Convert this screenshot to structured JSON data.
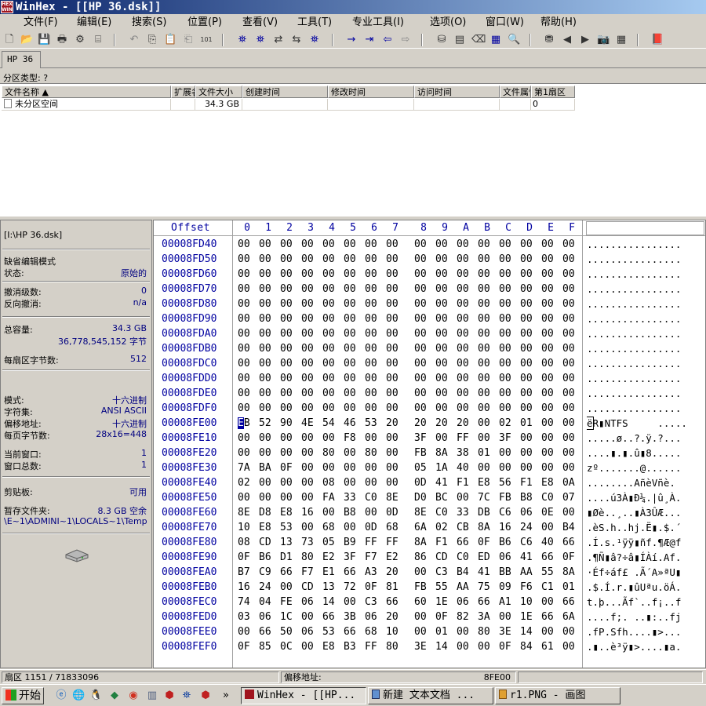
{
  "window": {
    "title": "WinHex - [[HP 36.dsk]]",
    "logo_top": "HEX",
    "logo_bottom": "WIN"
  },
  "menu": [
    {
      "label": "文件(F)"
    },
    {
      "label": "编辑(E)"
    },
    {
      "label": "搜索(S)"
    },
    {
      "label": "位置(P)"
    },
    {
      "label": "查看(V)"
    },
    {
      "label": "工具(T)"
    },
    {
      "label": "专业工具(I)"
    },
    {
      "label": "选项(O)"
    },
    {
      "label": "窗口(W)"
    },
    {
      "label": "帮助(H)"
    }
  ],
  "tab": {
    "label": "HP 36"
  },
  "partition_type": "分区类型: ?",
  "file_table": {
    "columns": [
      "文件名称 ▲",
      "扩展名",
      "文件大小",
      "创建时间",
      "修改时间",
      "访问时间",
      "文件属性",
      "第1扇区"
    ],
    "rows": [
      {
        "name": "未分区空间",
        "ext": "",
        "size": "34.3 GB",
        "created": "",
        "modified": "",
        "accessed": "",
        "attr": "",
        "first_sector": "0"
      }
    ]
  },
  "info": {
    "path": "[I:\\HP 36.dsk]",
    "edit_mode": "缺省编辑模式",
    "state_label": "状态:",
    "state_val": "原始的",
    "undo_level_label": "撤消级数:",
    "undo_level_val": "0",
    "reverse_undo_label": "反向撤消:",
    "reverse_undo_val": "n/a",
    "capacity_label": "总容量:",
    "capacity_val": "34.3 GB",
    "capacity_bytes": "36,778,545,152 字节",
    "bytes_per_sector_label": "每扇区字节数:",
    "bytes_per_sector_val": "512",
    "mode_label": "模式:",
    "mode_val": "十六进制",
    "charset_label": "字符集:",
    "charset_val": "ANSI ASCII",
    "offset_addr_label": "偏移地址:",
    "offset_addr_val": "十六进制",
    "bytes_per_page_label": "每页字节数:",
    "bytes_per_page_val": "28x16=448",
    "cur_window_label": "当前窗口:",
    "cur_window_val": "1",
    "window_count_label": "窗口总数:",
    "window_count_val": "1",
    "clipboard_label": "剪贴板:",
    "clipboard_val": "可用",
    "temp_folder_label": "暂存文件夹:",
    "temp_folder_val": "8.3 GB 空余",
    "temp_folder_path": "\\E~1\\ADMINI~1\\LOCALS~1\\Temp"
  },
  "hex": {
    "offset_header": "Offset",
    "columns": [
      "0",
      "1",
      "2",
      "3",
      "4",
      "5",
      "6",
      "7",
      "8",
      "9",
      "A",
      "B",
      "C",
      "D",
      "E",
      "F"
    ],
    "rows": [
      {
        "offset": "00008FD40",
        "hex": "00 00 00 00 00 00 00 00  00 00 00 00 00 00 00 00",
        "ascii": "................"
      },
      {
        "offset": "00008FD50",
        "hex": "00 00 00 00 00 00 00 00  00 00 00 00 00 00 00 00",
        "ascii": "................"
      },
      {
        "offset": "00008FD60",
        "hex": "00 00 00 00 00 00 00 00  00 00 00 00 00 00 00 00",
        "ascii": "................"
      },
      {
        "offset": "00008FD70",
        "hex": "00 00 00 00 00 00 00 00  00 00 00 00 00 00 00 00",
        "ascii": "................"
      },
      {
        "offset": "00008FD80",
        "hex": "00 00 00 00 00 00 00 00  00 00 00 00 00 00 00 00",
        "ascii": "................"
      },
      {
        "offset": "00008FD90",
        "hex": "00 00 00 00 00 00 00 00  00 00 00 00 00 00 00 00",
        "ascii": "................"
      },
      {
        "offset": "00008FDA0",
        "hex": "00 00 00 00 00 00 00 00  00 00 00 00 00 00 00 00",
        "ascii": "................"
      },
      {
        "offset": "00008FDB0",
        "hex": "00 00 00 00 00 00 00 00  00 00 00 00 00 00 00 00",
        "ascii": "................"
      },
      {
        "offset": "00008FDC0",
        "hex": "00 00 00 00 00 00 00 00  00 00 00 00 00 00 00 00",
        "ascii": "................"
      },
      {
        "offset": "00008FDD0",
        "hex": "00 00 00 00 00 00 00 00  00 00 00 00 00 00 00 00",
        "ascii": "................"
      },
      {
        "offset": "00008FDE0",
        "hex": "00 00 00 00 00 00 00 00  00 00 00 00 00 00 00 00",
        "ascii": "................"
      },
      {
        "offset": "00008FDF0",
        "hex": "00 00 00 00 00 00 00 00  00 00 00 00 00 00 00 00",
        "ascii": "................"
      },
      {
        "offset": "00008FE00",
        "hex": "EB 52 90 4E 54 46 53 20  20 20 20 00 02 01 00 00",
        "ascii": "ëR▮NTFS     ....."
      },
      {
        "offset": "00008FE10",
        "hex": "00 00 00 00 00 F8 00 00  3F 00 FF 00 3F 00 00 00",
        "ascii": ".....ø..?.ÿ.?..."
      },
      {
        "offset": "00008FE20",
        "hex": "00 00 00 00 80 00 80 00  FB 8A 38 01 00 00 00 00",
        "ascii": "....▮.▮.û▮8....."
      },
      {
        "offset": "00008FE30",
        "hex": "7A BA 0F 00 00 00 00 00  05 1A 40 00 00 00 00 00",
        "ascii": "zº.......@......"
      },
      {
        "offset": "00008FE40",
        "hex": "02 00 00 00 08 00 00 00  0D 41 F1 E8 56 F1 E8 0A",
        "ascii": "........AñèVñè."
      },
      {
        "offset": "00008FE50",
        "hex": "00 00 00 00 FA 33 C0 8E  D0 BC 00 7C FB B8 C0 07",
        "ascii": "....ú3À▮Ð¼.|û¸À."
      },
      {
        "offset": "00008FE60",
        "hex": "8E D8 E8 16 00 B8 00 0D  8E C0 33 DB C6 06 0E 00",
        "ascii": "▮Øè..¸..▮À3ÛÆ..."
      },
      {
        "offset": "00008FE70",
        "hex": "10 E8 53 00 68 00 0D 68  6A 02 CB 8A 16 24 00 B4",
        "ascii": ".èS.h..hj.Ë▮.$.´"
      },
      {
        "offset": "00008FE80",
        "hex": "08 CD 13 73 05 B9 FF FF  8A F1 66 0F B6 C6 40 66",
        "ascii": ".Í.s.¹ÿÿ▮ñf.¶Æ@f"
      },
      {
        "offset": "00008FE90",
        "hex": "0F B6 D1 80 E2 3F F7 E2  86 CD C0 ED 06 41 66 0F",
        "ascii": ".¶Ñ▮â?÷â▮ÍÀí.Af."
      },
      {
        "offset": "00008FEA0",
        "hex": "B7 C9 66 F7 E1 66 A3 20  00 C3 B4 41 BB AA 55 8A",
        "ascii": "·Éf÷áf£ .Ã´A»ªU▮"
      },
      {
        "offset": "00008FEB0",
        "hex": "16 24 00 CD 13 72 0F 81  FB 55 AA 75 09 F6 C1 01",
        "ascii": ".$.Í.r.▮ûUªu.öÁ."
      },
      {
        "offset": "00008FEC0",
        "hex": "74 04 FE 06 14 00 C3 66  60 1E 06 66 A1 10 00 66",
        "ascii": "t.þ...Ãf`..f¡..f"
      },
      {
        "offset": "00008FED0",
        "hex": "03 06 1C 00 66 3B 06 20  00 0F 82 3A 00 1E 66 6A",
        "ascii": "....f;. ..▮:..fj"
      },
      {
        "offset": "00008FEE0",
        "hex": "00 66 50 06 53 66 68 10  00 01 00 80 3E 14 00 00",
        "ascii": ".fP.Sfh....▮>..."
      },
      {
        "offset": "00008FEF0",
        "hex": "0F 85 0C 00 E8 B3 FF 80  3E 14 00 00 0F 84 61 00",
        "ascii": ".▮..è³ÿ▮>....▮a."
      }
    ]
  },
  "status": {
    "sector": "扇区 1151 / 71833096",
    "offset_label": "偏移地址:",
    "offset_val": "8FE00"
  },
  "taskbar": {
    "start": "开始",
    "more": "»",
    "tasks": [
      {
        "label": "WinHex - [[HP..."
      },
      {
        "label": "新建 文本文档 ..."
      },
      {
        "label": "r1.PNG - 画图"
      }
    ]
  }
}
